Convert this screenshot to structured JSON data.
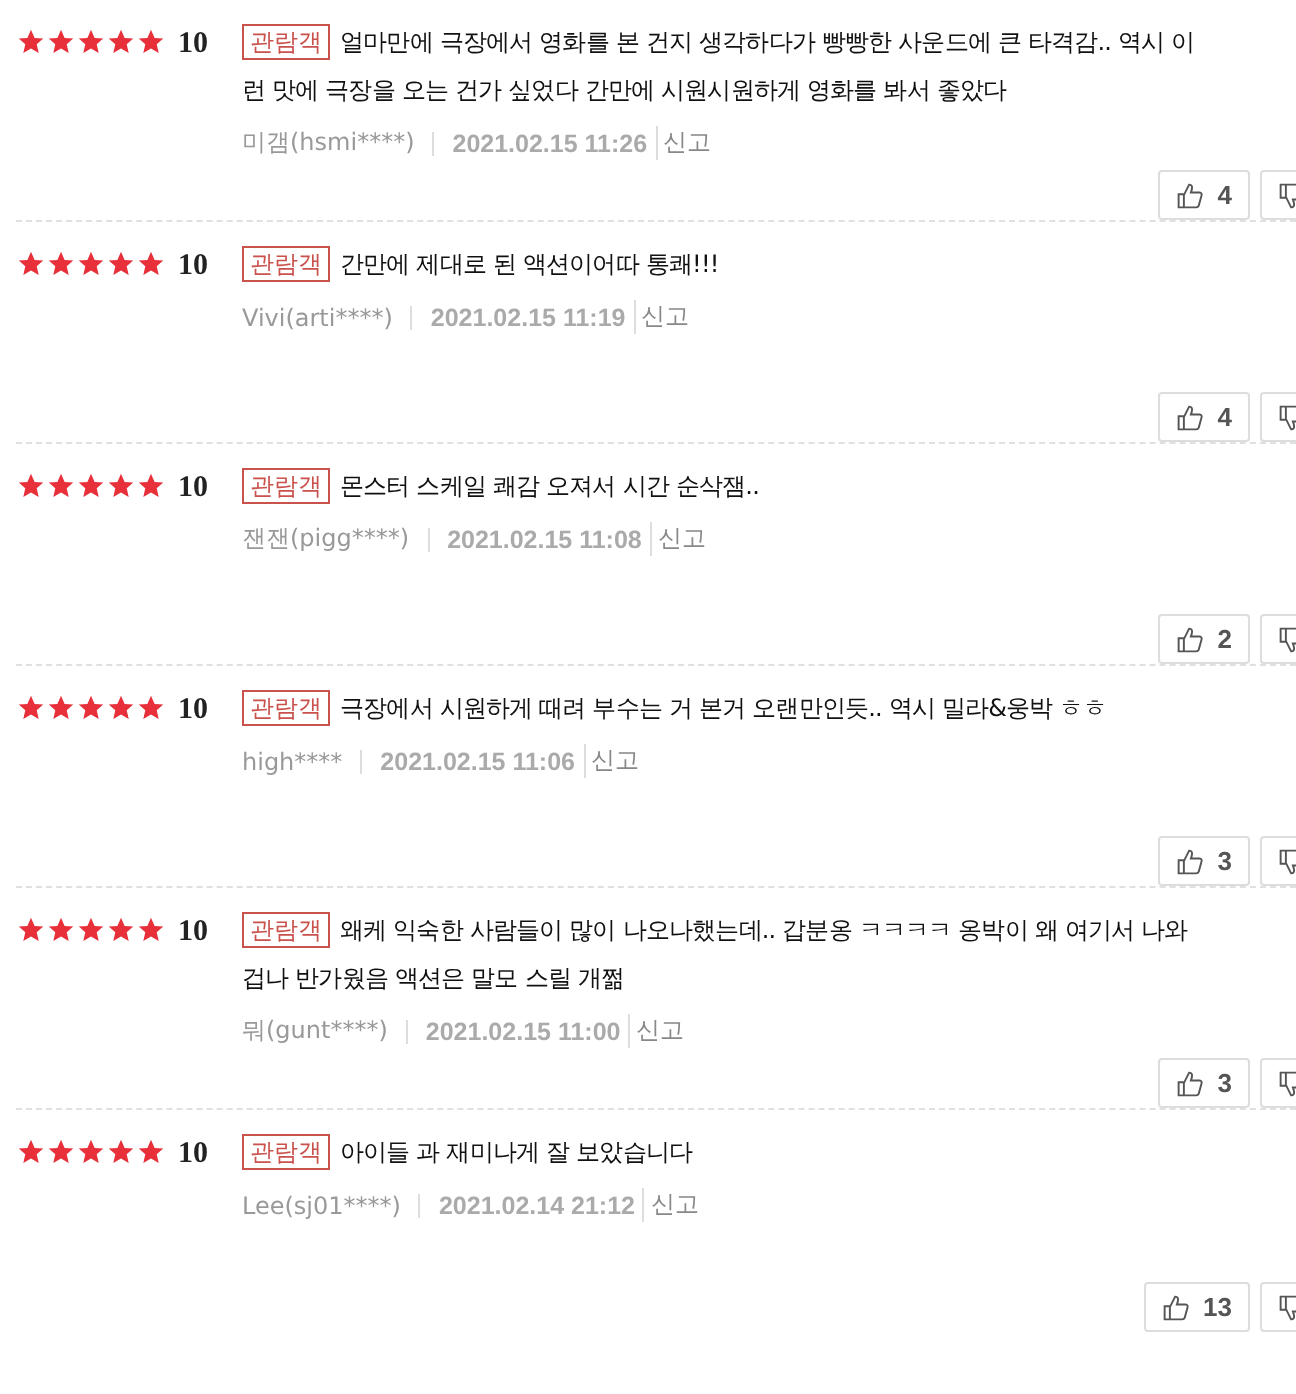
{
  "reviews": [
    {
      "stars": 5,
      "score": "10",
      "badge": "관람객",
      "lines": [
        "얼마만에 극장에서 영화를 본 건지 생각하다가 빵빵한 사운드에 큰 타격감.. 역시 이",
        "런 맛에 극장을 오는 건가 싶었다 간만에 시원시원하게 영화를 봐서 좋았다"
      ],
      "author": "미갬(hsmi****)",
      "date": "2021.02.15 11:26",
      "report": "신고",
      "likes": "4"
    },
    {
      "stars": 5,
      "score": "10",
      "badge": "관람객",
      "lines": [
        "간만에 제대로 된 액션이어따 통쾌!!!"
      ],
      "author": "Vivi(arti****)",
      "date": "2021.02.15 11:19",
      "report": "신고",
      "likes": "4"
    },
    {
      "stars": 5,
      "score": "10",
      "badge": "관람객",
      "lines": [
        "몬스터 스케일 쾌감 오져서 시간 순삭잼.."
      ],
      "author": "잰잰(pigg****)",
      "date": "2021.02.15 11:08",
      "report": "신고",
      "likes": "2"
    },
    {
      "stars": 5,
      "score": "10",
      "badge": "관람객",
      "lines": [
        "극장에서 시원하게 때려 부수는 거 본거 오랜만인듯.. 역시 밀라&웅박 ㅎㅎ"
      ],
      "author": "high****",
      "date": "2021.02.15 11:06",
      "report": "신고",
      "likes": "3"
    },
    {
      "stars": 5,
      "score": "10",
      "badge": "관람객",
      "lines": [
        "왜케 익숙한 사람들이 많이 나오나했는데.. 갑분옹 ㅋㅋㅋㅋ 옹박이 왜 여기서 나와",
        "겁나 반가웠음 액션은 말모 스릴 개쩖"
      ],
      "author": "뭐(gunt****)",
      "date": "2021.02.15 11:00",
      "report": "신고",
      "likes": "3"
    },
    {
      "stars": 5,
      "score": "10",
      "badge": "관람객",
      "lines": [
        "아이들 과 재미나게 잘 보았습니다"
      ],
      "author": "Lee(sj01****)",
      "date": "2021.02.14 21:12",
      "report": "신고",
      "likes": "13"
    }
  ]
}
